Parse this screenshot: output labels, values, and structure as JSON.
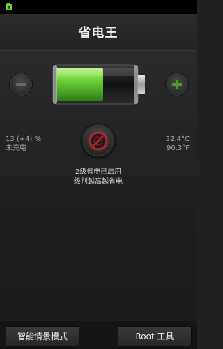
{
  "app": {
    "title": "省电王"
  },
  "status": {
    "charge_percent": "13 (+4) %",
    "charge_state": "未充电",
    "temp_c": "32.4°C",
    "temp_f": "90.3°F",
    "battery_level": 0.6
  },
  "mode": {
    "line1": "2级省电已启用",
    "line2": "级别越高越省电"
  },
  "bottom": {
    "smart_label": "智能情景模式",
    "root_label": "Root 工具"
  },
  "colors": {
    "accent_green": "#6fd43a",
    "power_red": "#b3252e",
    "background": "#202122"
  },
  "icons": {
    "decrease": "minus-icon",
    "increase": "plus-icon",
    "power": "power-icon",
    "notification": "notification-icon"
  }
}
